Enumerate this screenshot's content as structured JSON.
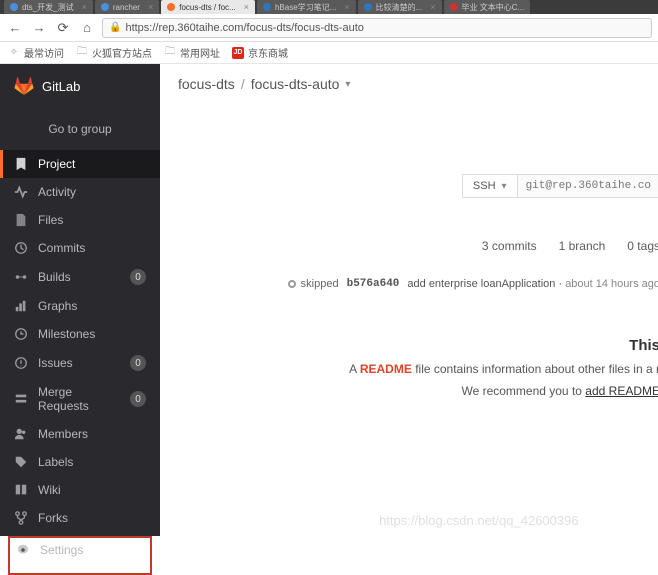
{
  "tabs": [
    {
      "label": "dts_开发_测试",
      "favicon": "blue"
    },
    {
      "label": "rancher",
      "favicon": "blue"
    },
    {
      "label": "focus-dts / foc...",
      "favicon": "orange",
      "active": true
    },
    {
      "label": "hBase学习笔记...",
      "favicon": "blue2"
    },
    {
      "label": "比较清楚的...",
      "favicon": "blue2"
    },
    {
      "label": "毕业 文本中心C...",
      "favicon": "red"
    }
  ],
  "url": "https://rep.360taihe.com/focus-dts/focus-dts-auto",
  "bookmarks": {
    "frequent": "最常访问",
    "firefox": "火狐官方站点",
    "common": "常用网址",
    "jd": "京东商城",
    "jd_icon": "JD"
  },
  "brand": "GitLab",
  "go_to_group": "Go to group",
  "sidebar": {
    "project": "Project",
    "activity": "Activity",
    "files": "Files",
    "commits": "Commits",
    "builds": "Builds",
    "builds_count": "0",
    "graphs": "Graphs",
    "milestones": "Milestones",
    "issues": "Issues",
    "issues_count": "0",
    "merge_requests": "Merge Requests",
    "mr_count": "0",
    "members": "Members",
    "labels": "Labels",
    "wiki": "Wiki",
    "forks": "Forks",
    "settings": "Settings"
  },
  "breadcrumb": {
    "group": "focus-dts",
    "project": "focus-dts-auto"
  },
  "clone": {
    "protocol": "SSH",
    "url": "git@rep.360taihe.co"
  },
  "stats": {
    "commits": "3 commits",
    "branches": "1 branch",
    "tags": "0 tags"
  },
  "pipeline": {
    "status": "skipped",
    "sha": "b576a640",
    "message": "add enterprise loanApplication",
    "time": "about 14 hours ago"
  },
  "readme": {
    "title": "This",
    "prefix": "A",
    "link": "README",
    "desc": "file contains information about other files in a r",
    "recommend": "We recommend you to",
    "add": "add README"
  },
  "watermark": "https://blog.csdn.net/qq_42600396"
}
